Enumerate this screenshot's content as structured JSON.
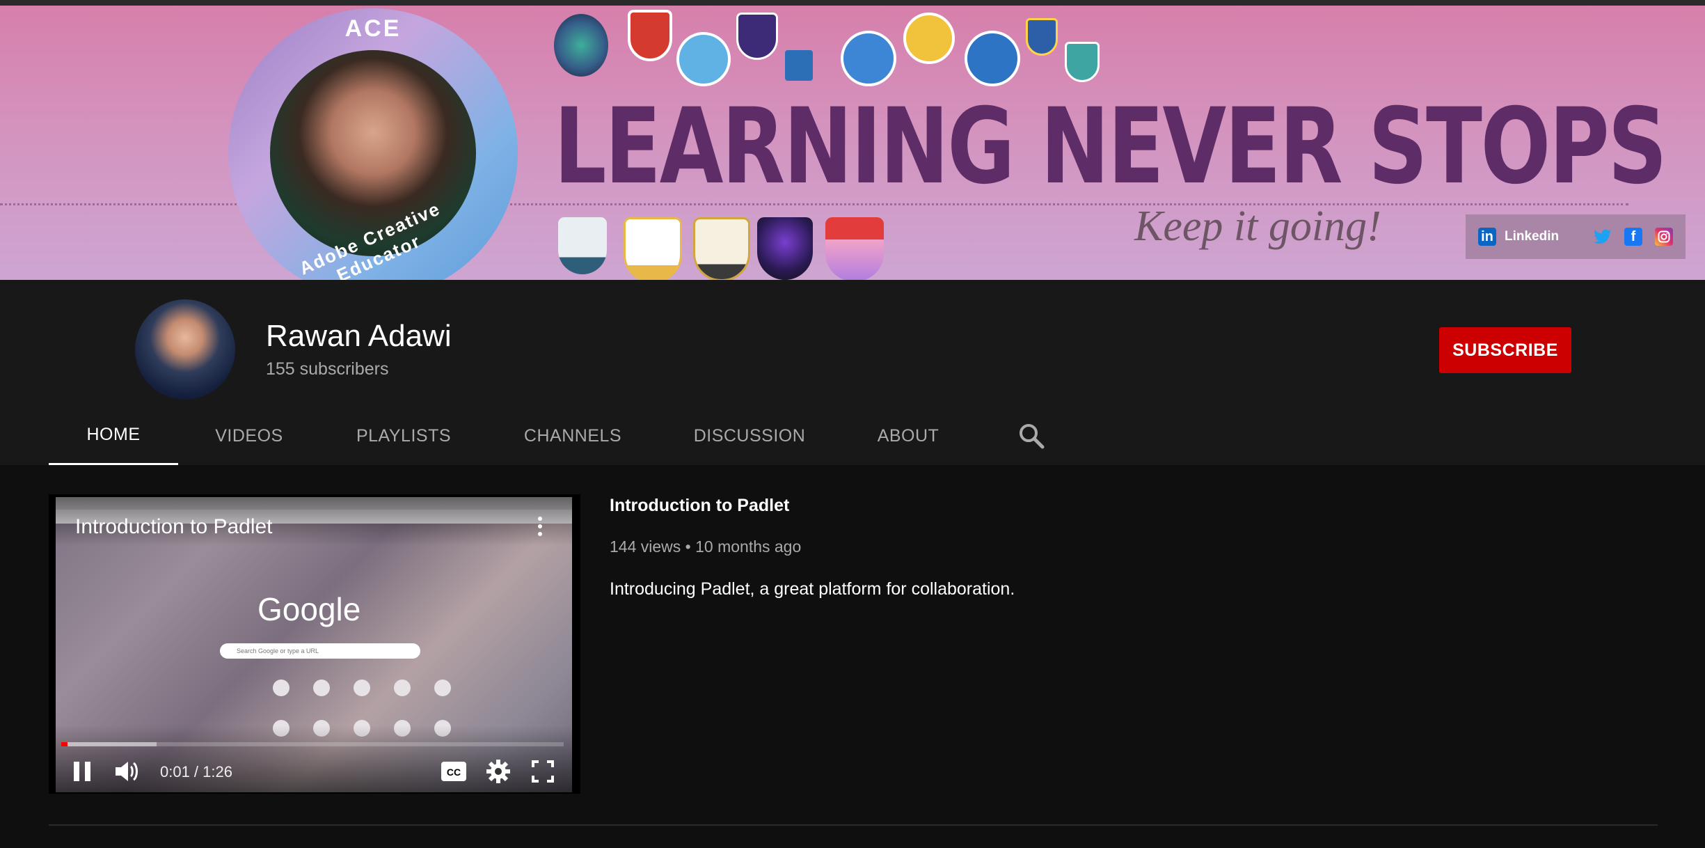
{
  "banner": {
    "headline": "LEARNING NEVER STOPS",
    "tagline": "Keep it going!",
    "ace_top": "ACE",
    "ace_bottom": "Adobe Creative Educator",
    "badges_bottom": [
      "MIE",
      "MIE EXPERT 2019-2020",
      "MIE EXPERT 2020-2021",
      "Certified Educator 1",
      "ADOBE CREATIVE EDUCATOR LEVEL 1"
    ],
    "social": {
      "linkedin_label": "Linkedin",
      "icons": [
        "linkedin-icon",
        "twitter-icon",
        "facebook-icon",
        "instagram-icon"
      ]
    }
  },
  "channel": {
    "name": "Rawan Adawi",
    "subscribers": "155 subscribers",
    "subscribe_label": "SUBSCRIBE"
  },
  "tabs": [
    {
      "label": "HOME",
      "active": true
    },
    {
      "label": "VIDEOS"
    },
    {
      "label": "PLAYLISTS"
    },
    {
      "label": "CHANNELS"
    },
    {
      "label": "DISCUSSION"
    },
    {
      "label": "ABOUT"
    }
  ],
  "player": {
    "overlay_title": "Introduction to Padlet",
    "google_logo": "Google",
    "search_placeholder": "Search Google or type a URL",
    "time": "0:01 / 1:26",
    "progress_played": 0.012,
    "progress_buffered": 0.19
  },
  "video": {
    "title": "Introduction to Padlet",
    "meta": "144 views • 10 months ago",
    "description": "Introducing Padlet, a great platform for collaboration."
  },
  "colors": {
    "subscribe": "#cc0000",
    "background": "#181818",
    "content_background": "#0f0f0f",
    "banner_title": "#5e2d67",
    "progress": "#ff0000"
  }
}
